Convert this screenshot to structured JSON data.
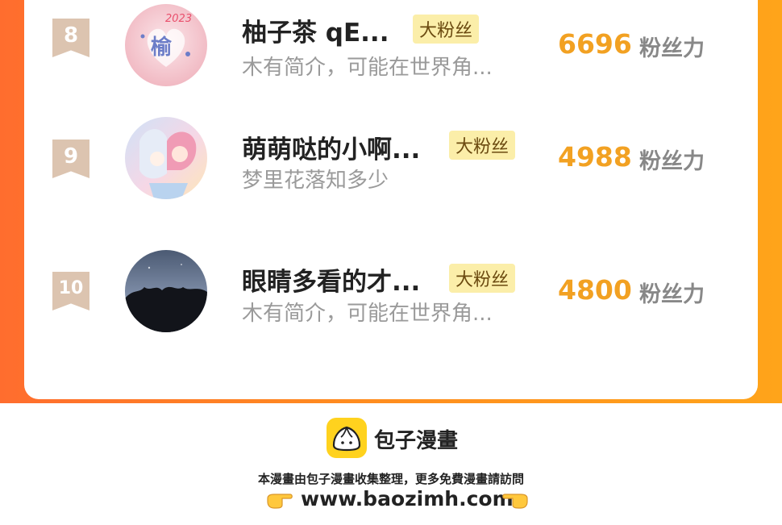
{
  "fans": [
    {
      "rank": "8",
      "name": "柚子茶 qE...",
      "badge": "大粉丝",
      "desc": "木有简介，可能在世界角...",
      "score": "6696",
      "score_label": "粉丝力",
      "avatar": {
        "year": "2023",
        "char": "榆"
      }
    },
    {
      "rank": "9",
      "name": "萌萌哒的小啊...",
      "badge": "大粉丝",
      "desc": "梦里花落知多少",
      "score": "4988",
      "score_label": "粉丝力"
    },
    {
      "rank": "10",
      "name": "眼睛多看的才...",
      "badge": "大粉丝",
      "desc": "木有简介，可能在世界角...",
      "score": "4800",
      "score_label": "粉丝力"
    }
  ],
  "footer": {
    "brand": "包子漫畫",
    "note": "本漫畫由包子漫畫收集整理，更多免費漫畫請訪問",
    "url": "www.baozimh.com"
  },
  "colors": {
    "frame_gradient": [
      "#ff6d2e",
      "#ffa41a"
    ],
    "score": "#f2a122",
    "badge_bg": "#fbeea9",
    "rank_ribbon": "#dcc4b0",
    "logo_bg": "#ffd21e"
  },
  "icons": [
    "ribbon-rank-icon",
    "baozi-logo-icon",
    "pointing-hand-right-icon",
    "pointing-hand-left-icon"
  ]
}
